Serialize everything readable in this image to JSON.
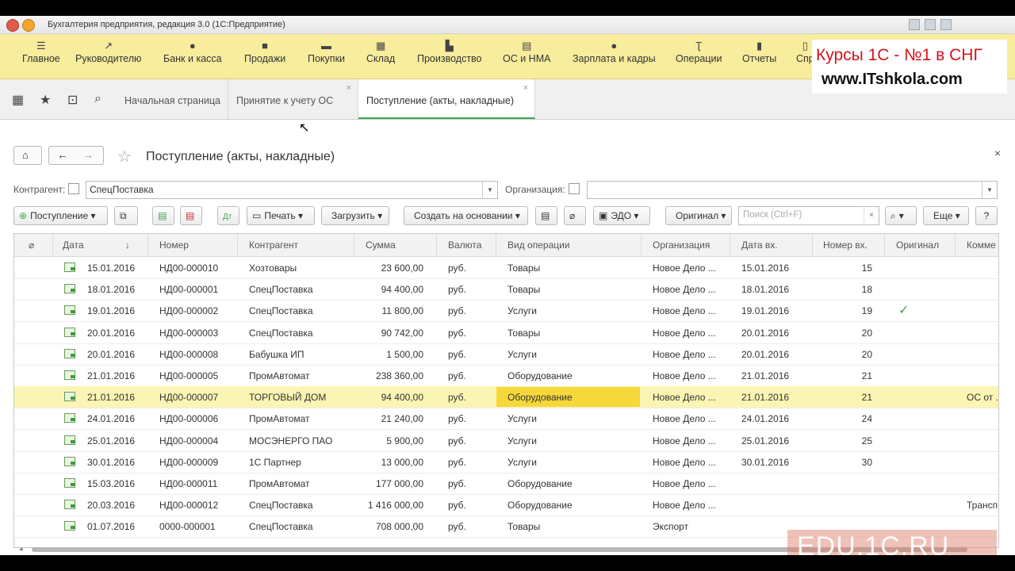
{
  "window": {
    "title": "Бухгалтерия предприятия, редакция 3.0  (1С:Предприятие)"
  },
  "main_menu": [
    {
      "label": "Главное",
      "icon": "menu-icon"
    },
    {
      "label": "Руководителю",
      "icon": "chart-icon"
    },
    {
      "label": "Банк и касса",
      "icon": "coin-icon"
    },
    {
      "label": "Продажи",
      "icon": "bag-icon"
    },
    {
      "label": "Покупки",
      "icon": "cart-icon"
    },
    {
      "label": "Склад",
      "icon": "grid-icon"
    },
    {
      "label": "Производство",
      "icon": "factory-icon"
    },
    {
      "label": "ОС и НМА",
      "icon": "assets-icon"
    },
    {
      "label": "Зарплата и кадры",
      "icon": "person-icon"
    },
    {
      "label": "Операции",
      "icon": "operations-icon"
    },
    {
      "label": "Отчеты",
      "icon": "reports-icon"
    },
    {
      "label": "Спр",
      "icon": "reference-icon"
    }
  ],
  "promo": {
    "line1": "Курсы 1С - №1 в СНГ",
    "line2": "www.ITshkola.com"
  },
  "tabs": [
    {
      "label": "Начальная страница"
    },
    {
      "label": "Принятие к учету ОС",
      "close": "×"
    },
    {
      "label": "Поступление (акты, накладные)",
      "close": "×"
    }
  ],
  "document": {
    "title": "Поступление (акты, накладные)"
  },
  "filters": {
    "contractor_label": "Контрагент:",
    "contractor_value": "СпецПоставка",
    "organization_label": "Организация:",
    "organization_value": ""
  },
  "toolbar": {
    "receipt": "Поступление",
    "print": "Печать",
    "load": "Загрузить",
    "create_based": "Создать на основании",
    "edo": "ЭДО",
    "original": "Оригинал",
    "search_placeholder": "Поиск (Ctrl+F)",
    "more": "Еще",
    "help": "?"
  },
  "table": {
    "columns": [
      "Дата",
      "Номер",
      "Контрагент",
      "Сумма",
      "Валюта",
      "Вид операции",
      "Организация",
      "Дата вх.",
      "Номер вх.",
      "Оригинал",
      "Комме"
    ],
    "rows": [
      {
        "date": "15.01.2016",
        "num": "НД00-000010",
        "contractor": "Хозтовары",
        "sum": "23 600,00",
        "cur": "руб.",
        "op": "Товары",
        "org": "Новое Дело ...",
        "date_in": "15.01.2016",
        "num_in": "15",
        "original": "",
        "comment": ""
      },
      {
        "date": "18.01.2016",
        "num": "НД00-000001",
        "contractor": "СпецПоставка",
        "sum": "94 400,00",
        "cur": "руб.",
        "op": "Товары",
        "org": "Новое Дело ...",
        "date_in": "18.01.2016",
        "num_in": "18",
        "original": "",
        "comment": ""
      },
      {
        "date": "19.01.2016",
        "num": "НД00-000002",
        "contractor": "СпецПоставка",
        "sum": "11 800,00",
        "cur": "руб.",
        "op": "Услуги",
        "org": "Новое Дело ...",
        "date_in": "19.01.2016",
        "num_in": "19",
        "original": "✓",
        "comment": ""
      },
      {
        "date": "20.01.2016",
        "num": "НД00-000003",
        "contractor": "СпецПоставка",
        "sum": "90 742,00",
        "cur": "руб.",
        "op": "Товары",
        "org": "Новое Дело ...",
        "date_in": "20.01.2016",
        "num_in": "20",
        "original": "",
        "comment": ""
      },
      {
        "date": "20.01.2016",
        "num": "НД00-000008",
        "contractor": "Бабушка ИП",
        "sum": "1 500,00",
        "cur": "руб.",
        "op": "Услуги",
        "org": "Новое Дело ...",
        "date_in": "20.01.2016",
        "num_in": "20",
        "original": "",
        "comment": ""
      },
      {
        "date": "21.01.2016",
        "num": "НД00-000005",
        "contractor": "ПромАвтомат",
        "sum": "238 360,00",
        "cur": "руб.",
        "op": "Оборудование",
        "org": "Новое Дело ...",
        "date_in": "21.01.2016",
        "num_in": "21",
        "original": "",
        "comment": ""
      },
      {
        "date": "21.01.2016",
        "num": "НД00-000007",
        "contractor": "ТОРГОВЫЙ ДОМ",
        "sum": "94 400,00",
        "cur": "руб.",
        "op": "Оборудование",
        "org": "Новое Дело ...",
        "date_in": "21.01.2016",
        "num_in": "21",
        "original": "",
        "comment": "ОС от ..."
      },
      {
        "date": "24.01.2016",
        "num": "НД00-000006",
        "contractor": "ПромАвтомат",
        "sum": "21 240,00",
        "cur": "руб.",
        "op": "Услуги",
        "org": "Новое Дело ...",
        "date_in": "24.01.2016",
        "num_in": "24",
        "original": "",
        "comment": ""
      },
      {
        "date": "25.01.2016",
        "num": "НД00-000004",
        "contractor": "МОСЭНЕРГО ПАО",
        "sum": "5 900,00",
        "cur": "руб.",
        "op": "Услуги",
        "org": "Новое Дело ...",
        "date_in": "25.01.2016",
        "num_in": "25",
        "original": "",
        "comment": ""
      },
      {
        "date": "30.01.2016",
        "num": "НД00-000009",
        "contractor": "1С Партнер",
        "sum": "13 000,00",
        "cur": "руб.",
        "op": "Услуги",
        "org": "Новое Дело ...",
        "date_in": "30.01.2016",
        "num_in": "30",
        "original": "",
        "comment": ""
      },
      {
        "date": "15.03.2016",
        "num": "НД00-000011",
        "contractor": "ПромАвтомат",
        "sum": "177 000,00",
        "cur": "руб.",
        "op": "Оборудование",
        "org": "Новое Дело ...",
        "date_in": "",
        "num_in": "",
        "original": "",
        "comment": ""
      },
      {
        "date": "20.03.2016",
        "num": "НД00-000012",
        "contractor": "СпецПоставка",
        "sum": "1 416 000,00",
        "cur": "руб.",
        "op": "Оборудование",
        "org": "Новое Дело ...",
        "date_in": "",
        "num_in": "",
        "original": "",
        "comment": "Трансп"
      },
      {
        "date": "01.07.2016",
        "num": "0000-000001",
        "contractor": "СпецПоставка",
        "sum": "708 000,00",
        "cur": "руб.",
        "op": "Товары",
        "org": "Экспорт",
        "date_in": "",
        "num_in": "",
        "original": "",
        "comment": ""
      }
    ]
  },
  "selected_row": 6,
  "watermark": "EDU.1C.RU",
  "colors": {
    "menu_bg": "#f8ec9d",
    "selected_row": "#fbf5b3",
    "selected_cell": "#f5d93a",
    "accent_green": "#3ea84a"
  }
}
